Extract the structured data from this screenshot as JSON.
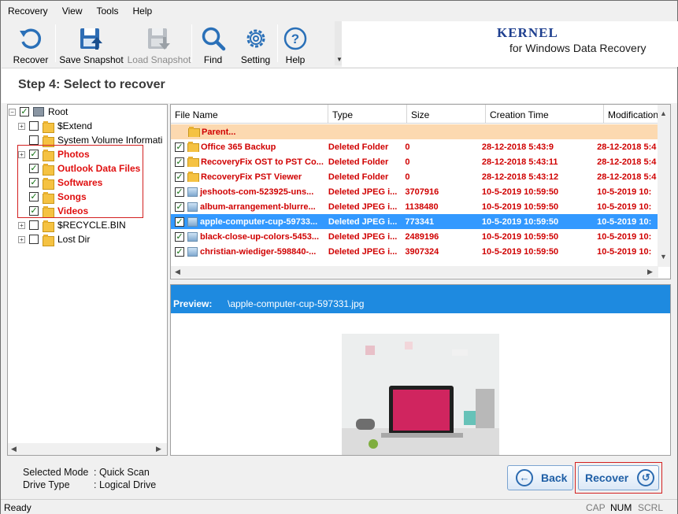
{
  "menu": [
    "Recovery",
    "View",
    "Tools",
    "Help"
  ],
  "toolbar": {
    "recover": "Recover",
    "save_snapshot": "Save Snapshot",
    "load_snapshot": "Load Snapshot",
    "find": "Find",
    "setting": "Setting",
    "help": "Help"
  },
  "brand": {
    "name": "KERNEL",
    "sub": "for Windows Data Recovery"
  },
  "step_title": "Step 4: Select to recover",
  "tree": [
    {
      "label": "Root",
      "checked": true,
      "red": false
    },
    {
      "label": "$Extend",
      "checked": false,
      "red": false
    },
    {
      "label": "System Volume Informati",
      "checked": false,
      "red": false
    },
    {
      "label": "Photos",
      "checked": true,
      "red": true
    },
    {
      "label": "Outlook Data Files",
      "checked": true,
      "red": true
    },
    {
      "label": "Softwares",
      "checked": true,
      "red": true
    },
    {
      "label": "Songs",
      "checked": true,
      "red": true
    },
    {
      "label": "Videos",
      "checked": true,
      "red": true
    },
    {
      "label": "$RECYCLE.BIN",
      "checked": false,
      "red": false
    },
    {
      "label": "Lost Dir",
      "checked": false,
      "red": false
    }
  ],
  "file_columns": [
    "File Name",
    "Type",
    "Size",
    "Creation Time",
    "Modification"
  ],
  "files": [
    {
      "name": "Parent...",
      "type": "",
      "size": "",
      "created": "",
      "modified": "",
      "kind": "parent"
    },
    {
      "name": "Office 365 Backup",
      "type": "Deleted Folder",
      "size": "0",
      "created": "28-12-2018 5:43:9",
      "modified": "28-12-2018 5:4",
      "kind": "folder"
    },
    {
      "name": "RecoveryFix OST to PST Co...",
      "type": "Deleted Folder",
      "size": "0",
      "created": "28-12-2018 5:43:11",
      "modified": "28-12-2018 5:4",
      "kind": "folder"
    },
    {
      "name": "RecoveryFix PST Viewer",
      "type": "Deleted Folder",
      "size": "0",
      "created": "28-12-2018 5:43:12",
      "modified": "28-12-2018 5:4",
      "kind": "folder"
    },
    {
      "name": "jeshoots-com-523925-uns...",
      "type": "Deleted JPEG i...",
      "size": "3707916",
      "created": "10-5-2019 10:59:50",
      "modified": "10-5-2019 10:",
      "kind": "image"
    },
    {
      "name": "album-arrangement-blurre...",
      "type": "Deleted JPEG i...",
      "size": "1138480",
      "created": "10-5-2019 10:59:50",
      "modified": "10-5-2019 10:",
      "kind": "image"
    },
    {
      "name": "apple-computer-cup-59733...",
      "type": "Deleted JPEG i...",
      "size": "773341",
      "created": "10-5-2019 10:59:50",
      "modified": "10-5-2019 10:",
      "kind": "image",
      "selected": true
    },
    {
      "name": "black-close-up-colors-5453...",
      "type": "Deleted JPEG i...",
      "size": "2489196",
      "created": "10-5-2019 10:59:50",
      "modified": "10-5-2019 10:",
      "kind": "image"
    },
    {
      "name": "christian-wiediger-598840-...",
      "type": "Deleted JPEG i...",
      "size": "3907324",
      "created": "10-5-2019 10:59:50",
      "modified": "10-5-2019 10:",
      "kind": "image"
    }
  ],
  "preview": {
    "label": "Preview:",
    "path": "\\apple-computer-cup-597331.jpg"
  },
  "status_info": {
    "mode_key": "Selected Mode",
    "mode_val": ": Quick Scan",
    "drive_key": "Drive Type",
    "drive_val": ": Logical Drive"
  },
  "buttons": {
    "back": "Back",
    "recover": "Recover"
  },
  "statusbar": {
    "ready": "Ready",
    "cap": "CAP",
    "num": "NUM",
    "scrl": "SCRL"
  },
  "colors": {
    "accent": "#1e8ae0",
    "selection": "#3399ff",
    "deleted_text": "#d00000",
    "brand": "#1e3f8f"
  }
}
